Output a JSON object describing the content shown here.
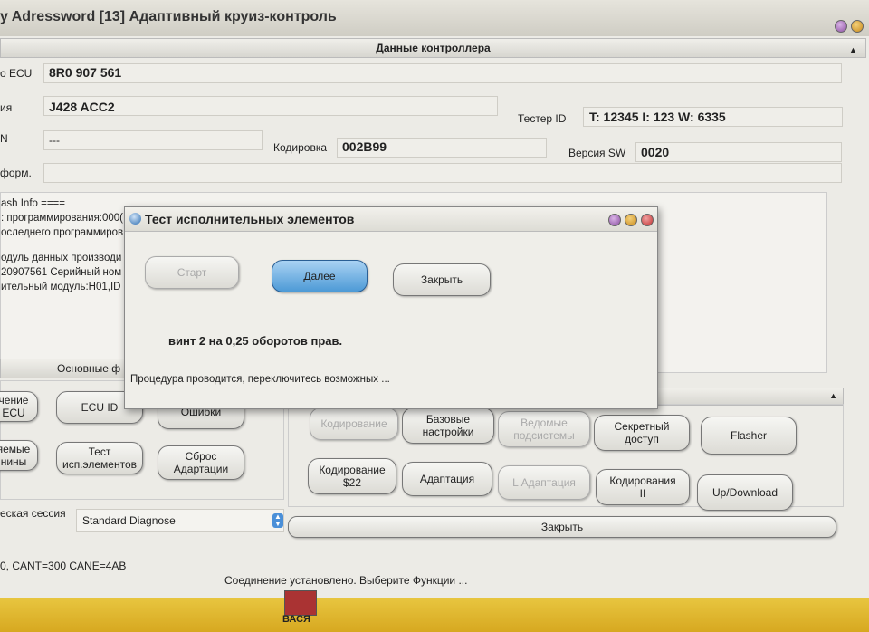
{
  "window": {
    "title": "y Adressword [13] Адаптивный круиз-контроль",
    "section_title": "Данные контроллера"
  },
  "controller": {
    "ecu_label": "о ECU",
    "ecu_value": "8R0 907 561",
    "name_label": "ия",
    "name_value": "J428 ACC2",
    "tester_label": "Тестер ID",
    "tester_value": "T: 12345 I: 123 W: 6335",
    "vin_label": "N",
    "vin_value": "---",
    "coding_label": "Кодировка",
    "coding_value": "002B99",
    "sw_label": "Версия SW",
    "sw_value": "0020",
    "info_label": "форм."
  },
  "flash_info": [
    "ash Info ====",
    ": программирования:000(",
    "оследнего программиров",
    "",
    "одуль данных производи",
    "20907561   Серийный ном",
    "ительный модуль:H01,ID"
  ],
  "left_tab": "Основные ф",
  "left_buttons": [
    "чение\nECU",
    "ECU ID",
    "Ошибки",
    "яемые\nнины",
    "Тест\nисп.элементов",
    "Сброс\nАдартации"
  ],
  "right_buttons": [
    {
      "label": "Кодирование",
      "enabled": false
    },
    {
      "label": "Базовые\nнастройки",
      "enabled": true
    },
    {
      "label": "Ведомые\nподсистемы",
      "enabled": false
    },
    {
      "label": "Секретный\nдоступ",
      "enabled": true
    },
    {
      "label": "Flasher",
      "enabled": true
    },
    {
      "label": "Кодирование\n$22",
      "enabled": true
    },
    {
      "label": "Адаптация",
      "enabled": true
    },
    {
      "label": "L Адаптация",
      "enabled": false
    },
    {
      "label": "Кодирования\nII",
      "enabled": true
    },
    {
      "label": "Up/Download",
      "enabled": true
    }
  ],
  "session": {
    "label": "еская сессия",
    "value": "Standard Diagnose"
  },
  "close_label": "Закрыть",
  "status": {
    "can": "0, CANT=300 CANE=4AB",
    "message": "Соединение установлено. Выберите Функции ..."
  },
  "taskbar_icon_label": "ВАСЯ",
  "dialog": {
    "title": "Тест исполнительных элементов",
    "start": "Старт",
    "next": "Далее",
    "close": "Закрыть",
    "instruction": "винт 2 на  0,25  оборотов  прав.",
    "status": "Процедура проводится, переключитесь возможных ..."
  }
}
